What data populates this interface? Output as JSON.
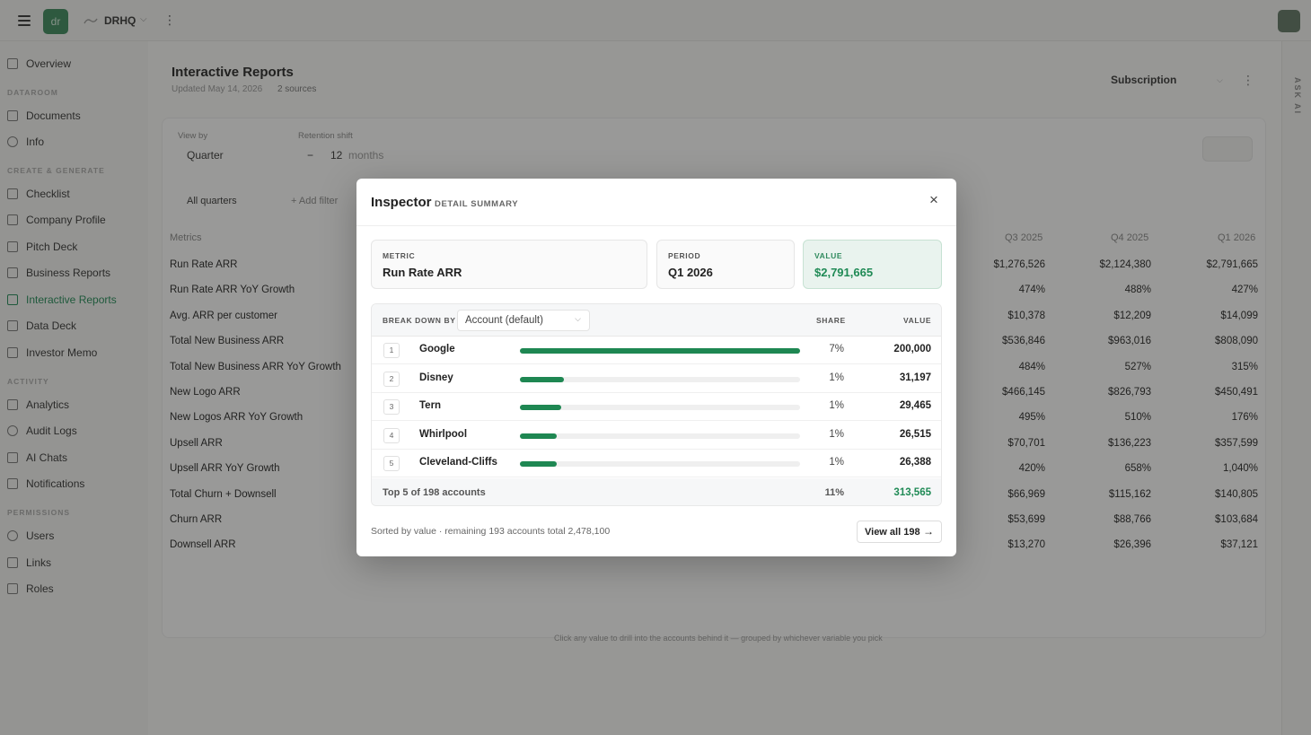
{
  "topbar": {
    "org_initials": "dr",
    "workspace": "DRHQ"
  },
  "sidebar": {
    "overview": "Overview",
    "sections": {
      "dataroom": "DATAROOM",
      "create": "CREATE & GENERATE",
      "activity": "ACTIVITY",
      "permissions": "PERMISSIONS"
    },
    "items": {
      "documents": "Documents",
      "info": "Info",
      "checklist": "Checklist",
      "company_profile": "Company Profile",
      "pitch_deck": "Pitch Deck",
      "business_reports": "Business Reports",
      "interactive_reports": "Interactive Reports",
      "data_deck": "Data Deck",
      "investor_memo": "Investor Memo",
      "analytics": "Analytics",
      "audit_logs": "Audit Logs",
      "ai_chats": "AI Chats",
      "notifications": "Notifications",
      "users": "Users",
      "links": "Links",
      "roles": "Roles"
    }
  },
  "page": {
    "title": "Interactive Reports",
    "updated": "Updated May 14, 2026",
    "sources": "2 sources",
    "subscription": "Subscription",
    "view_by_label": "View by",
    "view_by_value": "Quarter",
    "retention_label": "Retention shift",
    "retention_value": "12",
    "retention_unit": "months",
    "quarters_chip": "All quarters",
    "add_filter": "+ Add filter",
    "footnote": "Click any value to drill into the accounts behind it — grouped by whichever variable you pick",
    "ask_ai": "ASK AI"
  },
  "table": {
    "metrics_header": "Metrics",
    "columns": [
      "Q3 2025",
      "Q4 2025",
      "Q1 2026"
    ],
    "rows": [
      {
        "metric": "Run Rate ARR",
        "values": [
          "$1,276,526",
          "$2,124,380",
          "$2,791,665"
        ]
      },
      {
        "metric": "Run Rate ARR YoY Growth",
        "values": [
          "474%",
          "488%",
          "427%"
        ]
      },
      {
        "metric": "Avg. ARR per customer",
        "values": [
          "$10,378",
          "$12,209",
          "$14,099"
        ]
      },
      {
        "metric": "Total New Business ARR",
        "values": [
          "$536,846",
          "$963,016",
          "$808,090"
        ]
      },
      {
        "metric": "Total New Business ARR YoY Growth",
        "values": [
          "484%",
          "527%",
          "315%"
        ]
      },
      {
        "metric": "New Logo ARR",
        "values": [
          "$466,145",
          "$826,793",
          "$450,491"
        ]
      },
      {
        "metric": "New Logos ARR YoY Growth",
        "values": [
          "495%",
          "510%",
          "176%"
        ]
      },
      {
        "metric": "Upsell ARR",
        "values": [
          "$70,701",
          "$136,223",
          "$357,599"
        ]
      },
      {
        "metric": "Upsell ARR YoY Growth",
        "values": [
          "420%",
          "658%",
          "1,040%"
        ]
      },
      {
        "metric": "Total Churn + Downsell",
        "values": [
          "$66,969",
          "$115,162",
          "$140,805"
        ]
      },
      {
        "metric": "Churn ARR",
        "values": [
          "$53,699",
          "$88,766",
          "$103,684"
        ]
      },
      {
        "metric": "Downsell ARR",
        "values": [
          "$13,270",
          "$26,396",
          "$37,121"
        ]
      }
    ]
  },
  "modal": {
    "title": "Inspector",
    "subtitle": "DETAIL SUMMARY",
    "kpis": {
      "metric_label": "METRIC",
      "metric_value": "Run Rate ARR",
      "period_label": "PERIOD",
      "period_value": "Q1 2026",
      "value_label": "VALUE",
      "value_value": "$2,791,665"
    },
    "breakdown": {
      "label": "BREAK DOWN BY",
      "select": "Account (default)",
      "share_header": "SHARE",
      "value_header": "VALUE",
      "rows": [
        {
          "rank": "1",
          "account": "Google",
          "share": "7%",
          "value": "200,000",
          "bar": 1.0
        },
        {
          "rank": "2",
          "account": "Disney",
          "share": "1%",
          "value": "31,197",
          "bar": 0.156
        },
        {
          "rank": "3",
          "account": "Tern",
          "share": "1%",
          "value": "29,465",
          "bar": 0.147
        },
        {
          "rank": "4",
          "account": "Whirlpool",
          "share": "1%",
          "value": "26,515",
          "bar": 0.133
        },
        {
          "rank": "5",
          "account": "Cleveland-Cliffs",
          "share": "1%",
          "value": "26,388",
          "bar": 0.132
        }
      ],
      "footer_label": "Top 5 of 198 accounts",
      "footer_share": "11%",
      "footer_value": "313,565"
    },
    "note": "Sorted by value · remaining 193 accounts total 2,478,100",
    "view_all": "View all 198"
  },
  "colors": {
    "accent": "#1f8a55",
    "bar": "#1e8752"
  }
}
